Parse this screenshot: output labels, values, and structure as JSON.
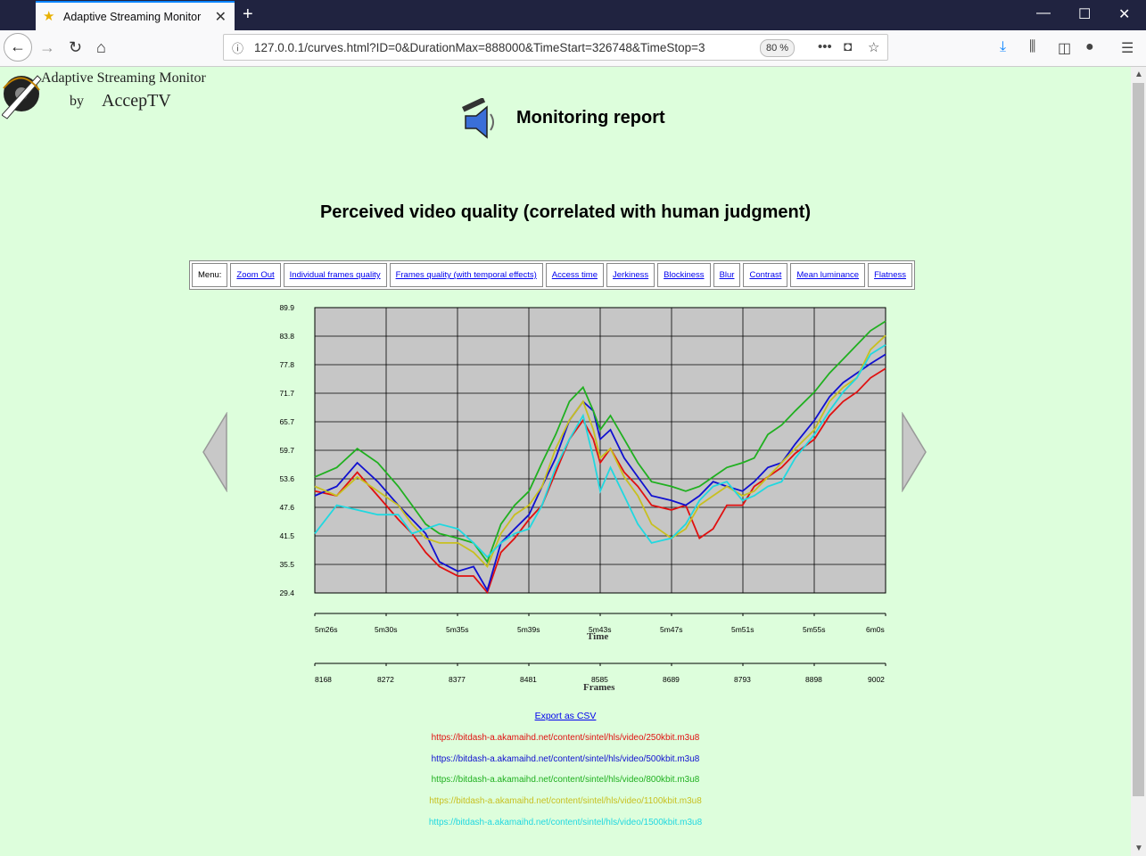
{
  "browser": {
    "tab_title": "Adaptive Streaming Monitor",
    "url": "127.0.0.1/curves.html?ID=0&DurationMax=888000&TimeStart=326748&TimeStop=3",
    "zoom": "80 %"
  },
  "logo": {
    "line1": "Adaptive Streaming Monitor",
    "by": "by",
    "brand": "AccepTV"
  },
  "report_title": "Monitoring report",
  "section_title": "Perceived video quality (correlated with human judgment)",
  "menu": {
    "label": "Menu:",
    "items": [
      "Zoom Out",
      "Individual frames quality",
      "Frames quality (with temporal effects)",
      "Access time",
      "Jerkiness",
      "Blockiness",
      "Blur",
      "Contrast",
      "Mean luminance",
      "Flatness"
    ]
  },
  "export_label": "Export as CSV",
  "legend": [
    {
      "url": "https://bitdash-a.akamaihd.net/content/sintel/hls/video/250kbit.m3u8",
      "color": "#e01010"
    },
    {
      "url": "https://bitdash-a.akamaihd.net/content/sintel/hls/video/500kbit.m3u8",
      "color": "#1010d0"
    },
    {
      "url": "https://bitdash-a.akamaihd.net/content/sintel/hls/video/800kbit.m3u8",
      "color": "#20b020"
    },
    {
      "url": "https://bitdash-a.akamaihd.net/content/sintel/hls/video/1100kbit.m3u8",
      "color": "#c8c020"
    },
    {
      "url": "https://bitdash-a.akamaihd.net/content/sintel/hls/video/1500kbit.m3u8",
      "color": "#20d8e0"
    }
  ],
  "chart_data": {
    "type": "line",
    "title": "Perceived video quality (correlated with human judgment)",
    "y_ticks": [
      "89.9",
      "83.8",
      "77.8",
      "71.7",
      "65.7",
      "59.7",
      "53.6",
      "47.6",
      "41.5",
      "35.5",
      "29.4"
    ],
    "ylim": [
      29.4,
      89.9
    ],
    "time_ticks": [
      "5m26s",
      "5m30s",
      "5m35s",
      "5m39s",
      "5m43s",
      "5m47s",
      "5m51s",
      "5m55s",
      "6m0s"
    ],
    "xlabel": "Time",
    "frame_ticks": [
      "8168",
      "8272",
      "8377",
      "8481",
      "8585",
      "8689",
      "8793",
      "8898",
      "9002"
    ],
    "xlabel2": "Frames",
    "xlim_frames": [
      8168,
      9002
    ],
    "grid": true,
    "x": [
      8168,
      8200,
      8230,
      8260,
      8290,
      8310,
      8330,
      8350,
      8377,
      8400,
      8420,
      8440,
      8460,
      8481,
      8500,
      8520,
      8540,
      8560,
      8575,
      8585,
      8600,
      8620,
      8640,
      8660,
      8689,
      8710,
      8730,
      8750,
      8770,
      8793,
      8810,
      8830,
      8850,
      8870,
      8898,
      8920,
      8940,
      8960,
      8980,
      9002
    ],
    "series": [
      {
        "name": "https://bitdash-a.akamaihd.net/content/sintel/hls/video/250kbit.m3u8",
        "color": "#e01010",
        "values": [
          51,
          50,
          55,
          50,
          45,
          42,
          38,
          35,
          33,
          33,
          29.5,
          38,
          41,
          45,
          48,
          55,
          62,
          66,
          62,
          57,
          60,
          55,
          52,
          48,
          47,
          48,
          41,
          43,
          48,
          48,
          52,
          54,
          56,
          59,
          62,
          67,
          70,
          72,
          75,
          77
        ]
      },
      {
        "name": "https://bitdash-a.akamaihd.net/content/sintel/hls/video/500kbit.m3u8",
        "color": "#1010d0",
        "values": [
          50,
          52,
          57,
          53,
          48,
          45,
          42,
          36,
          34,
          35,
          30,
          40,
          43,
          46,
          52,
          58,
          66,
          70,
          68,
          62,
          64,
          58,
          54,
          50,
          49,
          48,
          50,
          53,
          52,
          51,
          53,
          56,
          57,
          61,
          66,
          71,
          74,
          76,
          78,
          80
        ]
      },
      {
        "name": "https://bitdash-a.akamaihd.net/content/sintel/hls/video/800kbit.m3u8",
        "color": "#20b020",
        "values": [
          54,
          56,
          60,
          57,
          52,
          48,
          44,
          42,
          41,
          40,
          36,
          44,
          48,
          51,
          57,
          63,
          70,
          73,
          68,
          64,
          67,
          62,
          57,
          53,
          52,
          51,
          52,
          54,
          56,
          57,
          58,
          63,
          65,
          68,
          72,
          76,
          79,
          82,
          85,
          87
        ]
      },
      {
        "name": "https://bitdash-a.akamaihd.net/content/sintel/hls/video/1100kbit.m3u8",
        "color": "#c8c020",
        "values": [
          52,
          50,
          54,
          51,
          48,
          44,
          41,
          40,
          40,
          38,
          35,
          42,
          46,
          48,
          52,
          60,
          66,
          70,
          64,
          58,
          60,
          54,
          50,
          44,
          41,
          43,
          48,
          50,
          52,
          50,
          51,
          54,
          57,
          60,
          64,
          70,
          73,
          75,
          81,
          84
        ]
      },
      {
        "name": "https://bitdash-a.akamaihd.net/content/sintel/hls/video/1500kbit.m3u8",
        "color": "#20d8e0",
        "values": [
          42,
          48,
          47,
          46,
          46,
          42,
          43,
          44,
          43,
          40,
          37,
          40,
          42,
          43,
          48,
          56,
          62,
          67,
          58,
          51,
          56,
          50,
          44,
          40,
          41,
          44,
          49,
          52,
          53,
          49,
          50,
          52,
          53,
          58,
          63,
          68,
          72,
          75,
          80,
          82
        ]
      }
    ]
  }
}
